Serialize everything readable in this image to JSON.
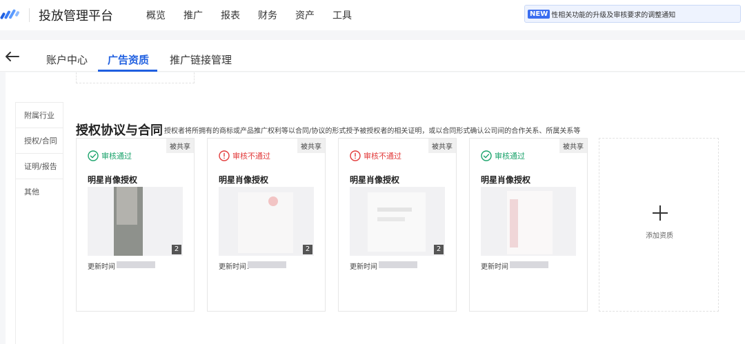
{
  "header": {
    "brand": "投放管理平台",
    "nav": [
      "概览",
      "推广",
      "报表",
      "财务",
      "资产",
      "工具"
    ],
    "notice_badge": "NEW",
    "notice_text": "性相关功能的升级及审核要求的调整通知"
  },
  "tabs": [
    "账户中心",
    "广告资质",
    "推广链接管理"
  ],
  "active_tab": "广告资质",
  "sidebar": [
    "附属行业",
    "授权/合同",
    "证明/报告",
    "其他"
  ],
  "section": {
    "title": "授权协议与合同",
    "description": "授权者将所拥有的商标或产品推广权利等以合同/协议的形式授予被授权者的相关证明，或以合同形式确认公司间的合作关系、所属关系等"
  },
  "cards": [
    {
      "shared": "被共享",
      "status": "审核通过",
      "status_type": "approved",
      "title": "明星肖像授权",
      "count": "2",
      "update_label": "更新时间"
    },
    {
      "shared": "被共享",
      "status": "审核不通过",
      "status_type": "rejected",
      "title": "明星肖像授权",
      "count": "2",
      "update_label": "更新时间："
    },
    {
      "shared": "被共享",
      "status": "审核不通过",
      "status_type": "rejected",
      "title": "明星肖像授权",
      "count": "2",
      "update_label": "更新时间"
    },
    {
      "shared": "被共享",
      "status": "审核通过",
      "status_type": "approved",
      "title": "明星肖像授权",
      "count": "",
      "update_label": "更新时间"
    }
  ],
  "add_card": {
    "label": "添加资质"
  },
  "colors": {
    "primary": "#1f5fe0",
    "approved": "#1aa36b",
    "rejected": "#e23a3a"
  }
}
